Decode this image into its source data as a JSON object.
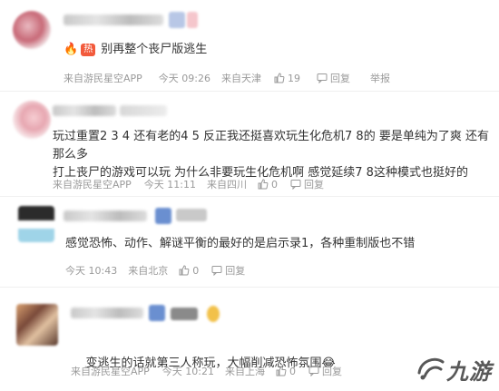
{
  "comments": [
    {
      "hot_label": "热",
      "text": "别再整个丧尸版逃生",
      "source": "来自游民星空APP",
      "time": "今天 09:26",
      "location": "来自天津",
      "likes": "19",
      "reply": "回复",
      "report": "举报"
    },
    {
      "text": "玩过重置2 3 4 还有老的4 5 反正我还挺喜欢玩生化危机7 8的 要是单纯为了爽 还有那么多\n打上丧尸的游戏可以玩 为什么非要玩生化危机啊 感觉延续7 8这种模式也挺好的",
      "source": "来自游民星空APP",
      "time": "今天 11:11",
      "location": "来自四川",
      "likes": "0",
      "reply": "回复"
    },
    {
      "text": "感觉恐怖、动作、解谜平衡的最好的是启示录1，各种重制版也不错",
      "time": "今天 10:43",
      "location": "来自北京",
      "likes": "0",
      "reply": "回复"
    },
    {
      "text": "变逃生的话就第三人称玩，大幅削减恐怖氛围",
      "emoji": "😂",
      "source": "来自游民星空APP",
      "time": "今天 10:21",
      "location": "来自上海",
      "likes": "0",
      "reply": "回复"
    }
  ],
  "watermark": {
    "text": "九游"
  },
  "colors": {
    "hot": "#f25a3c",
    "meta": "#9a9a9a",
    "text": "#333333"
  },
  "icons": {
    "like": "thumb-up-icon",
    "reply": "comment-icon",
    "hot": "fire-icon"
  }
}
